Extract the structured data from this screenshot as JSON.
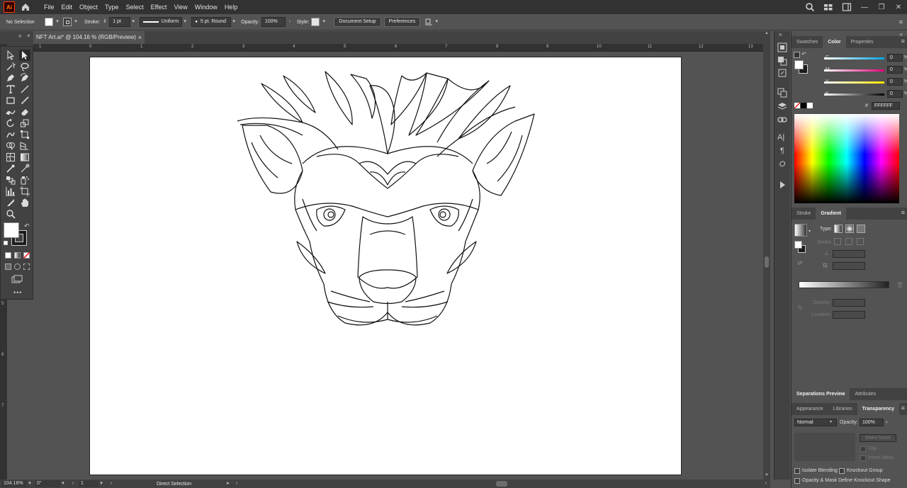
{
  "app": {
    "logo": "Ai"
  },
  "menu": [
    "File",
    "Edit",
    "Object",
    "Type",
    "Select",
    "Effect",
    "View",
    "Window",
    "Help"
  ],
  "control": {
    "selection": "No Selection",
    "stroke_label": "Stroke:",
    "stroke_weight": "1 pt",
    "profile": "Uniform",
    "brush": "5 pt. Round",
    "opacity_label": "Opacity:",
    "opacity": "100%",
    "style_label": "Style:",
    "document_setup": "Document Setup",
    "preferences": "Preferences"
  },
  "document": {
    "tab_title": "NFT Art.ai* @ 104.16 % (RGB/Preview)",
    "close": "×"
  },
  "ruler_h": [
    "1",
    "0",
    "1",
    "2",
    "3",
    "4",
    "5",
    "6",
    "7",
    "8",
    "9",
    "10",
    "11",
    "12",
    "13"
  ],
  "ruler_v": [
    "5",
    "6",
    "7"
  ],
  "status": {
    "zoom": "104.16%",
    "rotation": "0°",
    "artboard": "1",
    "tool": "Direct Selection"
  },
  "color_panel": {
    "tabs": [
      "Swatches",
      "Color",
      "Properties"
    ],
    "active": "Color",
    "channels": [
      {
        "label": "C",
        "value": "0",
        "unit": "%"
      },
      {
        "label": "M",
        "value": "0",
        "unit": "%"
      },
      {
        "label": "Y",
        "value": "0",
        "unit": "%"
      },
      {
        "label": "K",
        "value": "0",
        "unit": "%"
      }
    ],
    "hash": "#",
    "hex": "FFFFFF"
  },
  "gradient_panel": {
    "tabs": [
      "Stroke",
      "Gradient"
    ],
    "active": "Gradient",
    "type_label": "Type:",
    "stroke_label": "Stroke:",
    "opacity_label": "Opacity:",
    "location_label": "Location:"
  },
  "sep_panel": {
    "tabs": [
      "Separations Preview",
      "Attributes"
    ]
  },
  "transparency_panel": {
    "tabs": [
      "Appearance",
      "Libraries",
      "Transparency"
    ],
    "active": "Transparency",
    "blend_mode": "Normal",
    "opacity_label": "Opacity:",
    "opacity": "100%",
    "make_mask": "Make Mask",
    "clip": "Clip",
    "invert_mask": "Invert Mask",
    "isolate_blending": "Isolate Blending",
    "knockout_group": "Knockout Group",
    "opacity_mask_define": "Opacity & Mask Define Knockout Shape"
  },
  "colors": {
    "menubar": "#323232",
    "panel": "#535353",
    "panel_dark": "#424242",
    "accent": "#ff7c00"
  }
}
